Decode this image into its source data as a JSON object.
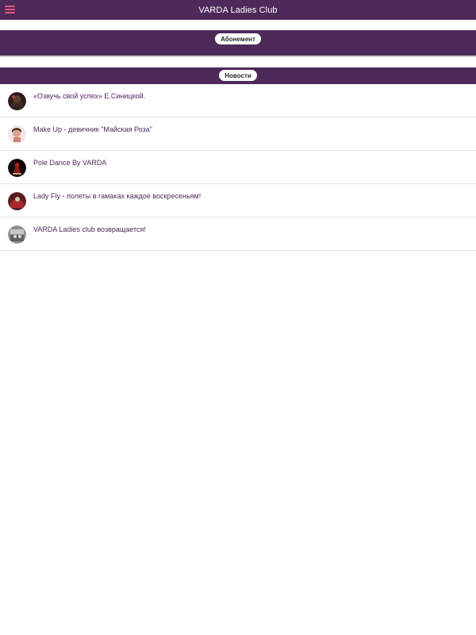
{
  "header": {
    "title": "VARDA Ladies Club",
    "menu_icon": "hamburger-menu-icon",
    "menu_color": "#e05a73"
  },
  "colors": {
    "brand": "#4e2a5a",
    "text": "#4e2a5a"
  },
  "sections": {
    "subscription_label": "Абонемент",
    "news_label": "Новости"
  },
  "news": [
    {
      "title": "«Озвучь свой успех» Е.Синицкой."
    },
    {
      "title": "Make Up - девичник \"Майская Роза\""
    },
    {
      "title": "Pole Dance By VARDA"
    },
    {
      "title": "Lady Fly - полеты в гамаках каждое воскресеньям!"
    },
    {
      "title": "VARDA Ladies club возвращается!"
    }
  ]
}
